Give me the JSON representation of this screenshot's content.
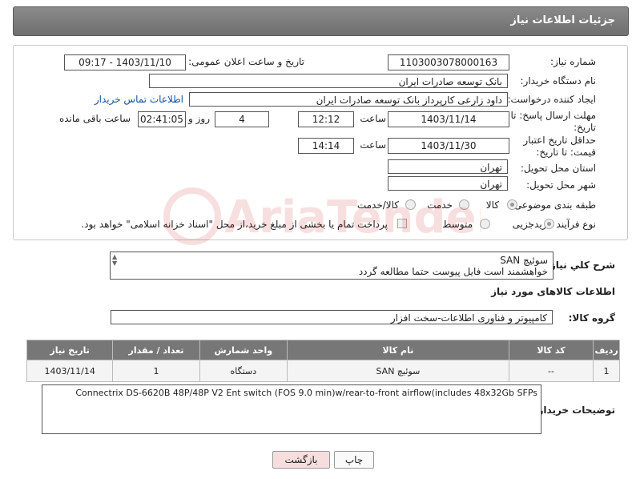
{
  "header": {
    "title": "جزئیات اطلاعات نیاز"
  },
  "form": {
    "need_number_label": "شماره نیاز:",
    "need_number": "1103003078000163",
    "announce_label": "تاریخ و ساعت اعلان عمومی:",
    "announce_value": "1403/11/10 - 09:17",
    "buyer_org_label": "نام دستگاه خریدار:",
    "buyer_org": "بانک توسعه صادرات ایران",
    "creator_label": "ایجاد کننده درخواست:",
    "creator": "داود زارعی کارپرداز بانک توسعه صادرات ایران",
    "contact_link": "اطلاعات تماس خریدار",
    "reply_deadline_label": "مهلت ارسال پاسخ: تا تاریخ:",
    "reply_date": "1403/11/14",
    "time_label": "ساعت",
    "reply_time": "12:12",
    "days_value": "4",
    "days_label": "روز و",
    "remaining_value": "02:41:05",
    "remaining_label": "ساعت باقی مانده",
    "price_validity_label": "حداقل تاریخ اعتبار قیمت: تا تاریخ:",
    "price_date": "1403/11/30",
    "price_time": "14:14",
    "province_label": "استان محل تحویل:",
    "province": "تهران",
    "city_label": "شهر محل تحویل:",
    "city": "تهران",
    "category_label": "طبقه بندی موضوعی:",
    "category_options": [
      "کالا",
      "خدمت",
      "کالا/خدمت"
    ],
    "process_label": "نوع فرآیند خرید :",
    "process_options": [
      "جزیی",
      "متوسط"
    ],
    "payment_note": "پرداخت تمام یا بخشی از مبلغ خرید،از محل \"اسناد خزانه اسلامی\" خواهد بود."
  },
  "description": {
    "label": "شرح كلي نياز:",
    "line1": "سوئیچ SAN",
    "line2": "خواهشمند است فایل پیوست حتما مطالعه گردد"
  },
  "goods": {
    "section_title": "اطلاعات کالاهای مورد نیاز",
    "group_label": "گروه کالا:",
    "group_value": "کامپیوتر و فناوری اطلاعات-سخت افزار",
    "columns": [
      "ردیف",
      "کد کالا",
      "نام کالا",
      "واحد شمارش",
      "تعداد / مقدار",
      "تاریخ نیاز"
    ],
    "rows": [
      {
        "row": "1",
        "code": "--",
        "name": "سوئیچ SAN",
        "unit": "دستگاه",
        "qty": "1",
        "date": "1403/11/14"
      }
    ]
  },
  "buyer_notes": {
    "label": "توضیحات خریدار:",
    "text": "Connectrix DS-6620B 48P/48P V2 Ent switch (FOS 9.0 min)w/rear-to-front airflow(includes 48x32Gb SFPs"
  },
  "buttons": {
    "print": "چاپ",
    "back": "بازگشت"
  },
  "watermark": {
    "text": "AriaTender.neT"
  },
  "colors": {
    "header": "#7a7a7a",
    "link": "#1a4fa0",
    "back_button": "#f7dede"
  }
}
